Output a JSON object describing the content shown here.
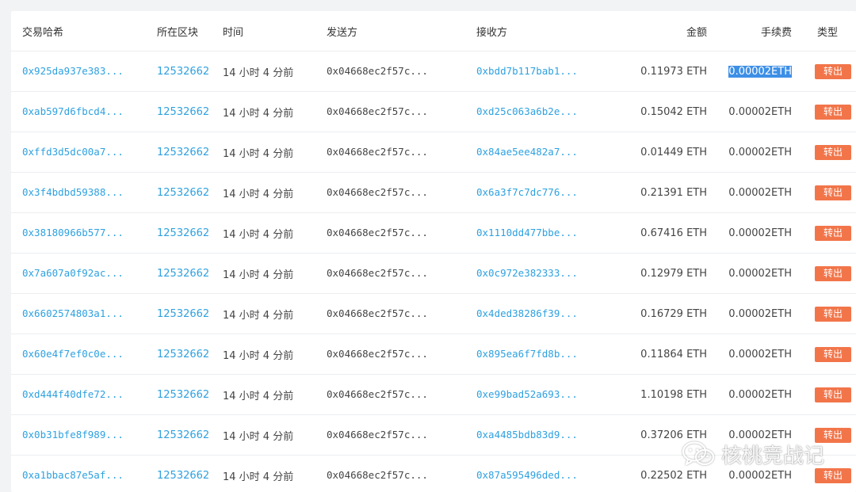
{
  "table": {
    "headers": {
      "hash": "交易哈希",
      "block": "所在区块",
      "time": "时间",
      "from": "发送方",
      "to": "接收方",
      "amount": "金额",
      "fee": "手续费",
      "type": "类型"
    },
    "rows": [
      {
        "hash": "0x925da937e383...",
        "block": "12532662",
        "time": "14 小时 4 分前",
        "from": "0x04668ec2f57c...",
        "to": "0xbdd7b117bab1...",
        "amount": "0.11973 ETH",
        "fee": "0.00002ETH",
        "type": "转出"
      },
      {
        "hash": "0xab597d6fbcd4...",
        "block": "12532662",
        "time": "14 小时 4 分前",
        "from": "0x04668ec2f57c...",
        "to": "0xd25c063a6b2e...",
        "amount": "0.15042 ETH",
        "fee": "0.00002ETH",
        "type": "转出"
      },
      {
        "hash": "0xffd3d5dc00a7...",
        "block": "12532662",
        "time": "14 小时 4 分前",
        "from": "0x04668ec2f57c...",
        "to": "0x84ae5ee482a7...",
        "amount": "0.01449 ETH",
        "fee": "0.00002ETH",
        "type": "转出"
      },
      {
        "hash": "0x3f4bdbd59388...",
        "block": "12532662",
        "time": "14 小时 4 分前",
        "from": "0x04668ec2f57c...",
        "to": "0x6a3f7c7dc776...",
        "amount": "0.21391 ETH",
        "fee": "0.00002ETH",
        "type": "转出"
      },
      {
        "hash": "0x38180966b577...",
        "block": "12532662",
        "time": "14 小时 4 分前",
        "from": "0x04668ec2f57c...",
        "to": "0x1110dd477bbe...",
        "amount": "0.67416 ETH",
        "fee": "0.00002ETH",
        "type": "转出"
      },
      {
        "hash": "0x7a607a0f92ac...",
        "block": "12532662",
        "time": "14 小时 4 分前",
        "from": "0x04668ec2f57c...",
        "to": "0x0c972e382333...",
        "amount": "0.12979 ETH",
        "fee": "0.00002ETH",
        "type": "转出"
      },
      {
        "hash": "0x6602574803a1...",
        "block": "12532662",
        "time": "14 小时 4 分前",
        "from": "0x04668ec2f57c...",
        "to": "0x4ded38286f39...",
        "amount": "0.16729 ETH",
        "fee": "0.00002ETH",
        "type": "转出"
      },
      {
        "hash": "0x60e4f7ef0c0e...",
        "block": "12532662",
        "time": "14 小时 4 分前",
        "from": "0x04668ec2f57c...",
        "to": "0x895ea6f7fd8b...",
        "amount": "0.11864 ETH",
        "fee": "0.00002ETH",
        "type": "转出"
      },
      {
        "hash": "0xd444f40dfe72...",
        "block": "12532662",
        "time": "14 小时 4 分前",
        "from": "0x04668ec2f57c...",
        "to": "0xe99bad52a693...",
        "amount": "1.10198 ETH",
        "fee": "0.00002ETH",
        "type": "转出"
      },
      {
        "hash": "0x0b31bfe8f989...",
        "block": "12532662",
        "time": "14 小时 4 分前",
        "from": "0x04668ec2f57c...",
        "to": "0xa4485bdb83d9...",
        "amount": "0.37206 ETH",
        "fee": "0.00002ETH",
        "type": "转出"
      },
      {
        "hash": "0xa1bbac87e5af...",
        "block": "12532662",
        "time": "14 小时 4 分前",
        "from": "0x04668ec2f57c...",
        "to": "0x87a595496ded...",
        "amount": "0.22502 ETH",
        "fee": "0.00002ETH",
        "type": "转出"
      }
    ]
  },
  "watermark": {
    "text": "核桃竞战记",
    "icon": "wechat-icon"
  },
  "colors": {
    "link": "#2ea1e0",
    "badge": "#f2754a",
    "selection": "#3d8fe6"
  }
}
